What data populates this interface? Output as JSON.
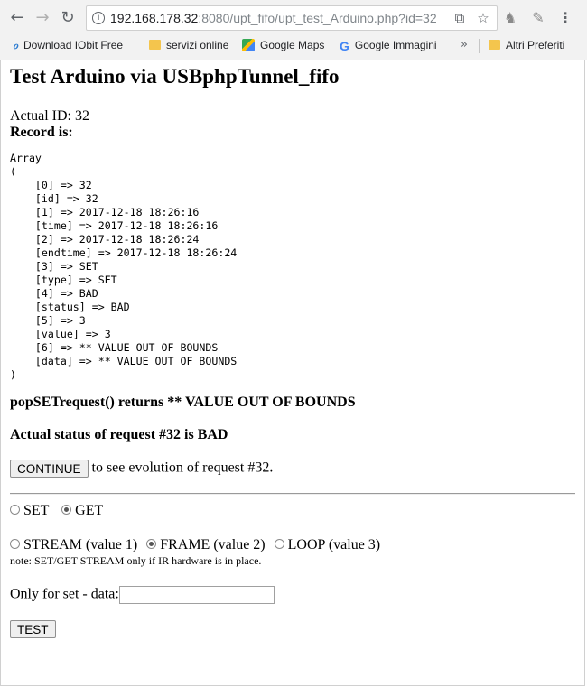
{
  "browser": {
    "url_host": "192.168.178.32",
    "url_rest": ":8080/upt_fifo/upt_test_Arduino.php?id=32",
    "bookmarks": [
      {
        "label": "Download IObit Free"
      },
      {
        "label": "servizi online"
      },
      {
        "label": "Google Maps"
      },
      {
        "label": "Google Immagini"
      },
      {
        "label": "Altri Preferiti"
      }
    ],
    "more_glyph": "»"
  },
  "page": {
    "title": "Test Arduino via USBphpTunnel_fifo",
    "actual_id": "Actual ID: 32",
    "record_label": "Record is:",
    "record_dump": "Array\n(\n    [0] => 32\n    [id] => 32\n    [1] => 2017-12-18 18:26:16\n    [time] => 2017-12-18 18:26:16\n    [2] => 2017-12-18 18:26:24\n    [endtime] => 2017-12-18 18:26:24\n    [3] => SET\n    [type] => SET\n    [4] => BAD\n    [status] => BAD\n    [5] => 3\n    [value] => 3\n    [6] => ** VALUE OUT OF BOUNDS\n    [data] => ** VALUE OUT OF BOUNDS\n)",
    "pop_result": "popSETrequest() returns ** VALUE OUT OF BOUNDS",
    "status_line": "Actual status of request #32 is BAD",
    "continue_label": "CONTINUE",
    "continue_suffix": " to see evolution of request #32.",
    "type_options": [
      {
        "label": "SET",
        "checked": false
      },
      {
        "label": "GET",
        "checked": true
      }
    ],
    "mode_options": [
      {
        "label": "STREAM (value 1)",
        "checked": false
      },
      {
        "label": "FRAME (value 2)",
        "checked": true
      },
      {
        "label": "LOOP (value 3)",
        "checked": false
      }
    ],
    "note": "note: SET/GET STREAM only if IR hardware is in place.",
    "data_label": "Only for set - data:",
    "data_value": "",
    "test_label": "TEST"
  }
}
